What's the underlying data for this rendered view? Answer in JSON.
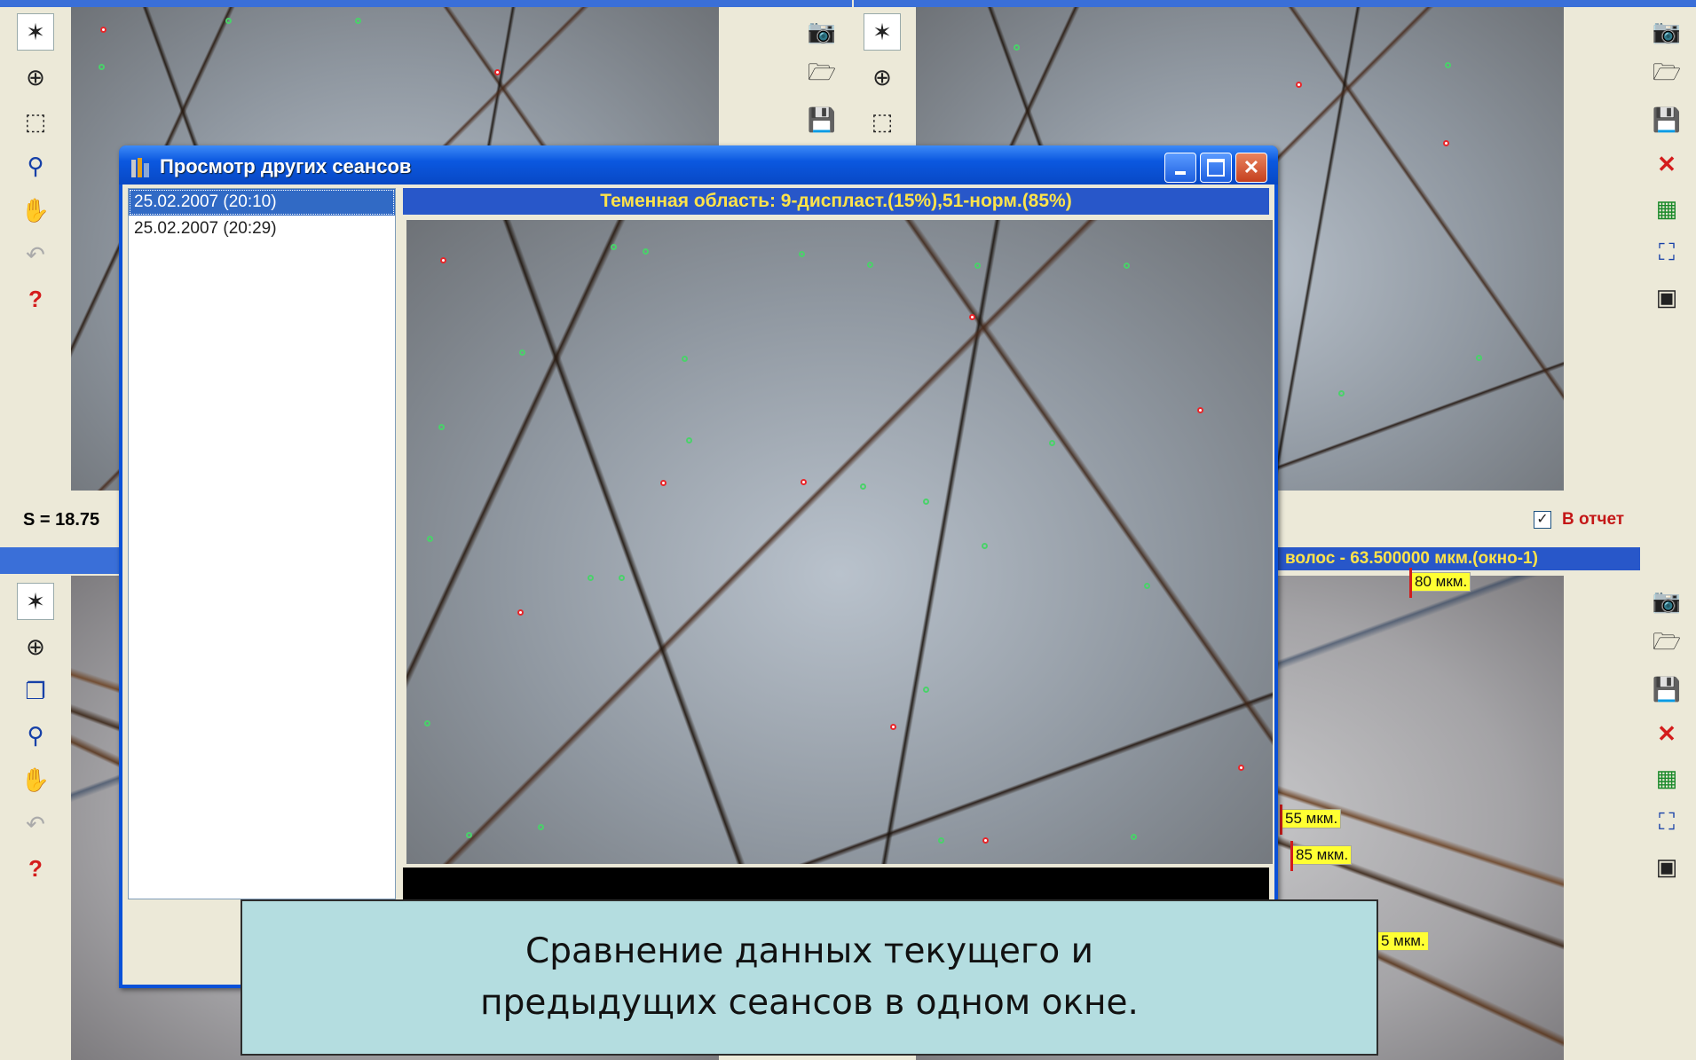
{
  "dialog": {
    "title": "Просмотр других сеансов",
    "sessions": [
      "25.02.2007 (20:10)",
      "25.02.2007 (20:29)"
    ],
    "selected_index": 0,
    "image_caption": "Теменная область: 9-диспласт.(15%),51-норм.(85%)",
    "buttons": {
      "minimize": "_",
      "maximize": "□",
      "close": "X"
    }
  },
  "panes": {
    "top_left": {
      "status": "S = 18.75"
    },
    "top_right": {
      "report_checkbox_label": "В отчет",
      "report_checked": true
    },
    "bottom_right": {
      "caption": "волос - 63.500000  мкм.(окно-1)",
      "measurements": [
        "80 мкм.",
        "55 мкм.",
        "85 мкм.",
        "5 мкм."
      ]
    }
  },
  "left_toolbar": {
    "icons": [
      "magic-wand-icon",
      "crosshair-icon",
      "selection-icon",
      "magnifier-icon",
      "hand-icon",
      "undo-icon",
      "help-icon"
    ],
    "help_label": "?"
  },
  "left_toolbar_bottom": {
    "icons": [
      "magic-wand-icon",
      "crosshair-icon",
      "layers-icon",
      "magnifier-icon",
      "hand-icon",
      "undo-icon",
      "help-icon"
    ]
  },
  "right_toolbar": {
    "icons": [
      "camera-icon",
      "folder-icon",
      "save-icon",
      "delete-icon",
      "grid-icon",
      "fit-icon",
      "window-icon"
    ],
    "delete_label": "✕"
  },
  "callout": {
    "line1": "Сравнение данных текущего и",
    "line2": "предыдущих сеансов в одном окне."
  },
  "colors": {
    "titlebar": "#0b58e0",
    "caption_bar": "#2857c9",
    "caption_text": "#ffe34a",
    "callout_bg": "#b4dde0",
    "marker_green": "#4ad16a",
    "marker_red": "#e8262a"
  }
}
